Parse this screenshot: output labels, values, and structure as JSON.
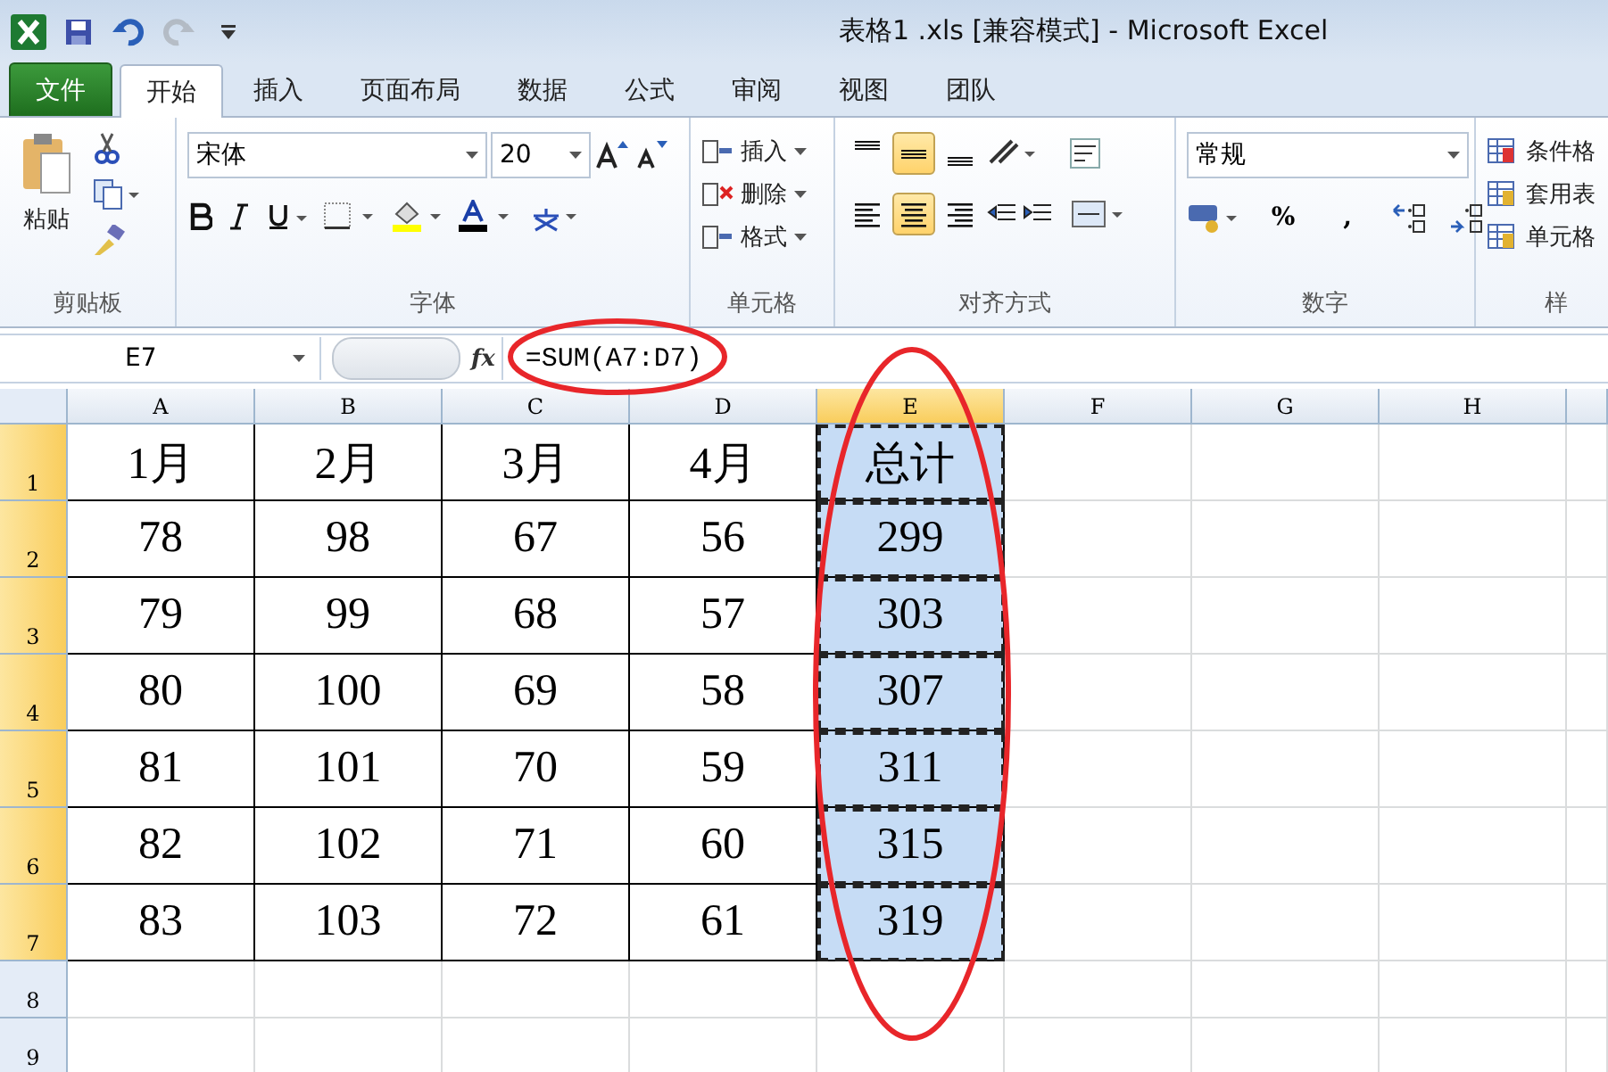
{
  "window": {
    "title": "表格1 .xls  [兼容模式]  -  Microsoft Excel"
  },
  "quick_access": [
    {
      "kind": "save",
      "disabled": false
    },
    {
      "kind": "undo",
      "disabled": false
    },
    {
      "kind": "redo",
      "disabled": true
    },
    {
      "kind": "customize",
      "disabled": false
    }
  ],
  "tabs": [
    {
      "label": "文件",
      "kind": "file",
      "selected": false
    },
    {
      "label": "开始",
      "kind": "tab",
      "selected": true
    },
    {
      "label": "插入",
      "kind": "tab",
      "selected": false
    },
    {
      "label": "页面布局",
      "kind": "tab",
      "selected": false
    },
    {
      "label": "数据",
      "kind": "tab",
      "selected": false
    },
    {
      "label": "公式",
      "kind": "tab",
      "selected": false
    },
    {
      "label": "审阅",
      "kind": "tab",
      "selected": false
    },
    {
      "label": "视图",
      "kind": "tab",
      "selected": false
    },
    {
      "label": "团队",
      "kind": "tab",
      "selected": false
    }
  ],
  "ribbon": {
    "clipboard": {
      "label": "剪贴板",
      "paste": "粘贴"
    },
    "font": {
      "label": "字体",
      "name": "宋体",
      "size": "20"
    },
    "cells": {
      "label": "单元格",
      "buttons": [
        "插入",
        "删除",
        "格式"
      ]
    },
    "alignment": {
      "label": "对齐方式",
      "top_row": [
        {
          "kind": "top",
          "selected": false
        },
        {
          "kind": "middle",
          "selected": true
        },
        {
          "kind": "bottom",
          "selected": false
        }
      ],
      "bottom_row": [
        {
          "kind": "left",
          "selected": false
        },
        {
          "kind": "center",
          "selected": true
        },
        {
          "kind": "right",
          "selected": false
        }
      ]
    },
    "number": {
      "label": "数字",
      "format": "常规",
      "percent": "%",
      "comma": ","
    },
    "styles": {
      "label": "样",
      "buttons": [
        "条件格",
        "套用表",
        "单元格"
      ]
    }
  },
  "formula_bar": {
    "name_box": "E7",
    "fx": "fx",
    "formula": "=SUM(A7:D7)"
  },
  "sheet": {
    "columns": [
      {
        "label": "A",
        "selected": false
      },
      {
        "label": "B",
        "selected": false
      },
      {
        "label": "C",
        "selected": false
      },
      {
        "label": "D",
        "selected": false
      },
      {
        "label": "E",
        "selected": true
      },
      {
        "label": "F",
        "selected": false
      },
      {
        "label": "G",
        "selected": false
      },
      {
        "label": "H",
        "selected": false
      }
    ],
    "rows": [
      {
        "header": "1",
        "selected": true,
        "cells": [
          {
            "text": "1月",
            "selected": false
          },
          {
            "text": "2月",
            "selected": false
          },
          {
            "text": "3月",
            "selected": false
          },
          {
            "text": "4月",
            "selected": false
          },
          {
            "text": "总计",
            "selected": true
          }
        ]
      },
      {
        "header": "2",
        "selected": true,
        "cells": [
          {
            "text": "78",
            "selected": false
          },
          {
            "text": "98",
            "selected": false
          },
          {
            "text": "67",
            "selected": false
          },
          {
            "text": "56",
            "selected": false
          },
          {
            "text": "299",
            "selected": true
          }
        ]
      },
      {
        "header": "3",
        "selected": true,
        "cells": [
          {
            "text": "79",
            "selected": false
          },
          {
            "text": "99",
            "selected": false
          },
          {
            "text": "68",
            "selected": false
          },
          {
            "text": "57",
            "selected": false
          },
          {
            "text": "303",
            "selected": true
          }
        ]
      },
      {
        "header": "4",
        "selected": true,
        "cells": [
          {
            "text": "80",
            "selected": false
          },
          {
            "text": "100",
            "selected": false
          },
          {
            "text": "69",
            "selected": false
          },
          {
            "text": "58",
            "selected": false
          },
          {
            "text": "307",
            "selected": true
          }
        ]
      },
      {
        "header": "5",
        "selected": true,
        "cells": [
          {
            "text": "81",
            "selected": false
          },
          {
            "text": "101",
            "selected": false
          },
          {
            "text": "70",
            "selected": false
          },
          {
            "text": "59",
            "selected": false
          },
          {
            "text": "311",
            "selected": true
          }
        ]
      },
      {
        "header": "6",
        "selected": true,
        "cells": [
          {
            "text": "82",
            "selected": false
          },
          {
            "text": "102",
            "selected": false
          },
          {
            "text": "71",
            "selected": false
          },
          {
            "text": "60",
            "selected": false
          },
          {
            "text": "315",
            "selected": true
          }
        ]
      },
      {
        "header": "7",
        "selected": true,
        "cells": [
          {
            "text": "83",
            "selected": false
          },
          {
            "text": "103",
            "selected": false
          },
          {
            "text": "72",
            "selected": false
          },
          {
            "text": "61",
            "selected": false
          },
          {
            "text": "319",
            "selected": true
          }
        ]
      },
      {
        "header": "8",
        "selected": false,
        "cells": []
      },
      {
        "header": "9",
        "selected": false,
        "cells": []
      }
    ]
  },
  "annotations": [
    {
      "kind": "ellipse"
    },
    {
      "kind": "ellipse"
    }
  ]
}
